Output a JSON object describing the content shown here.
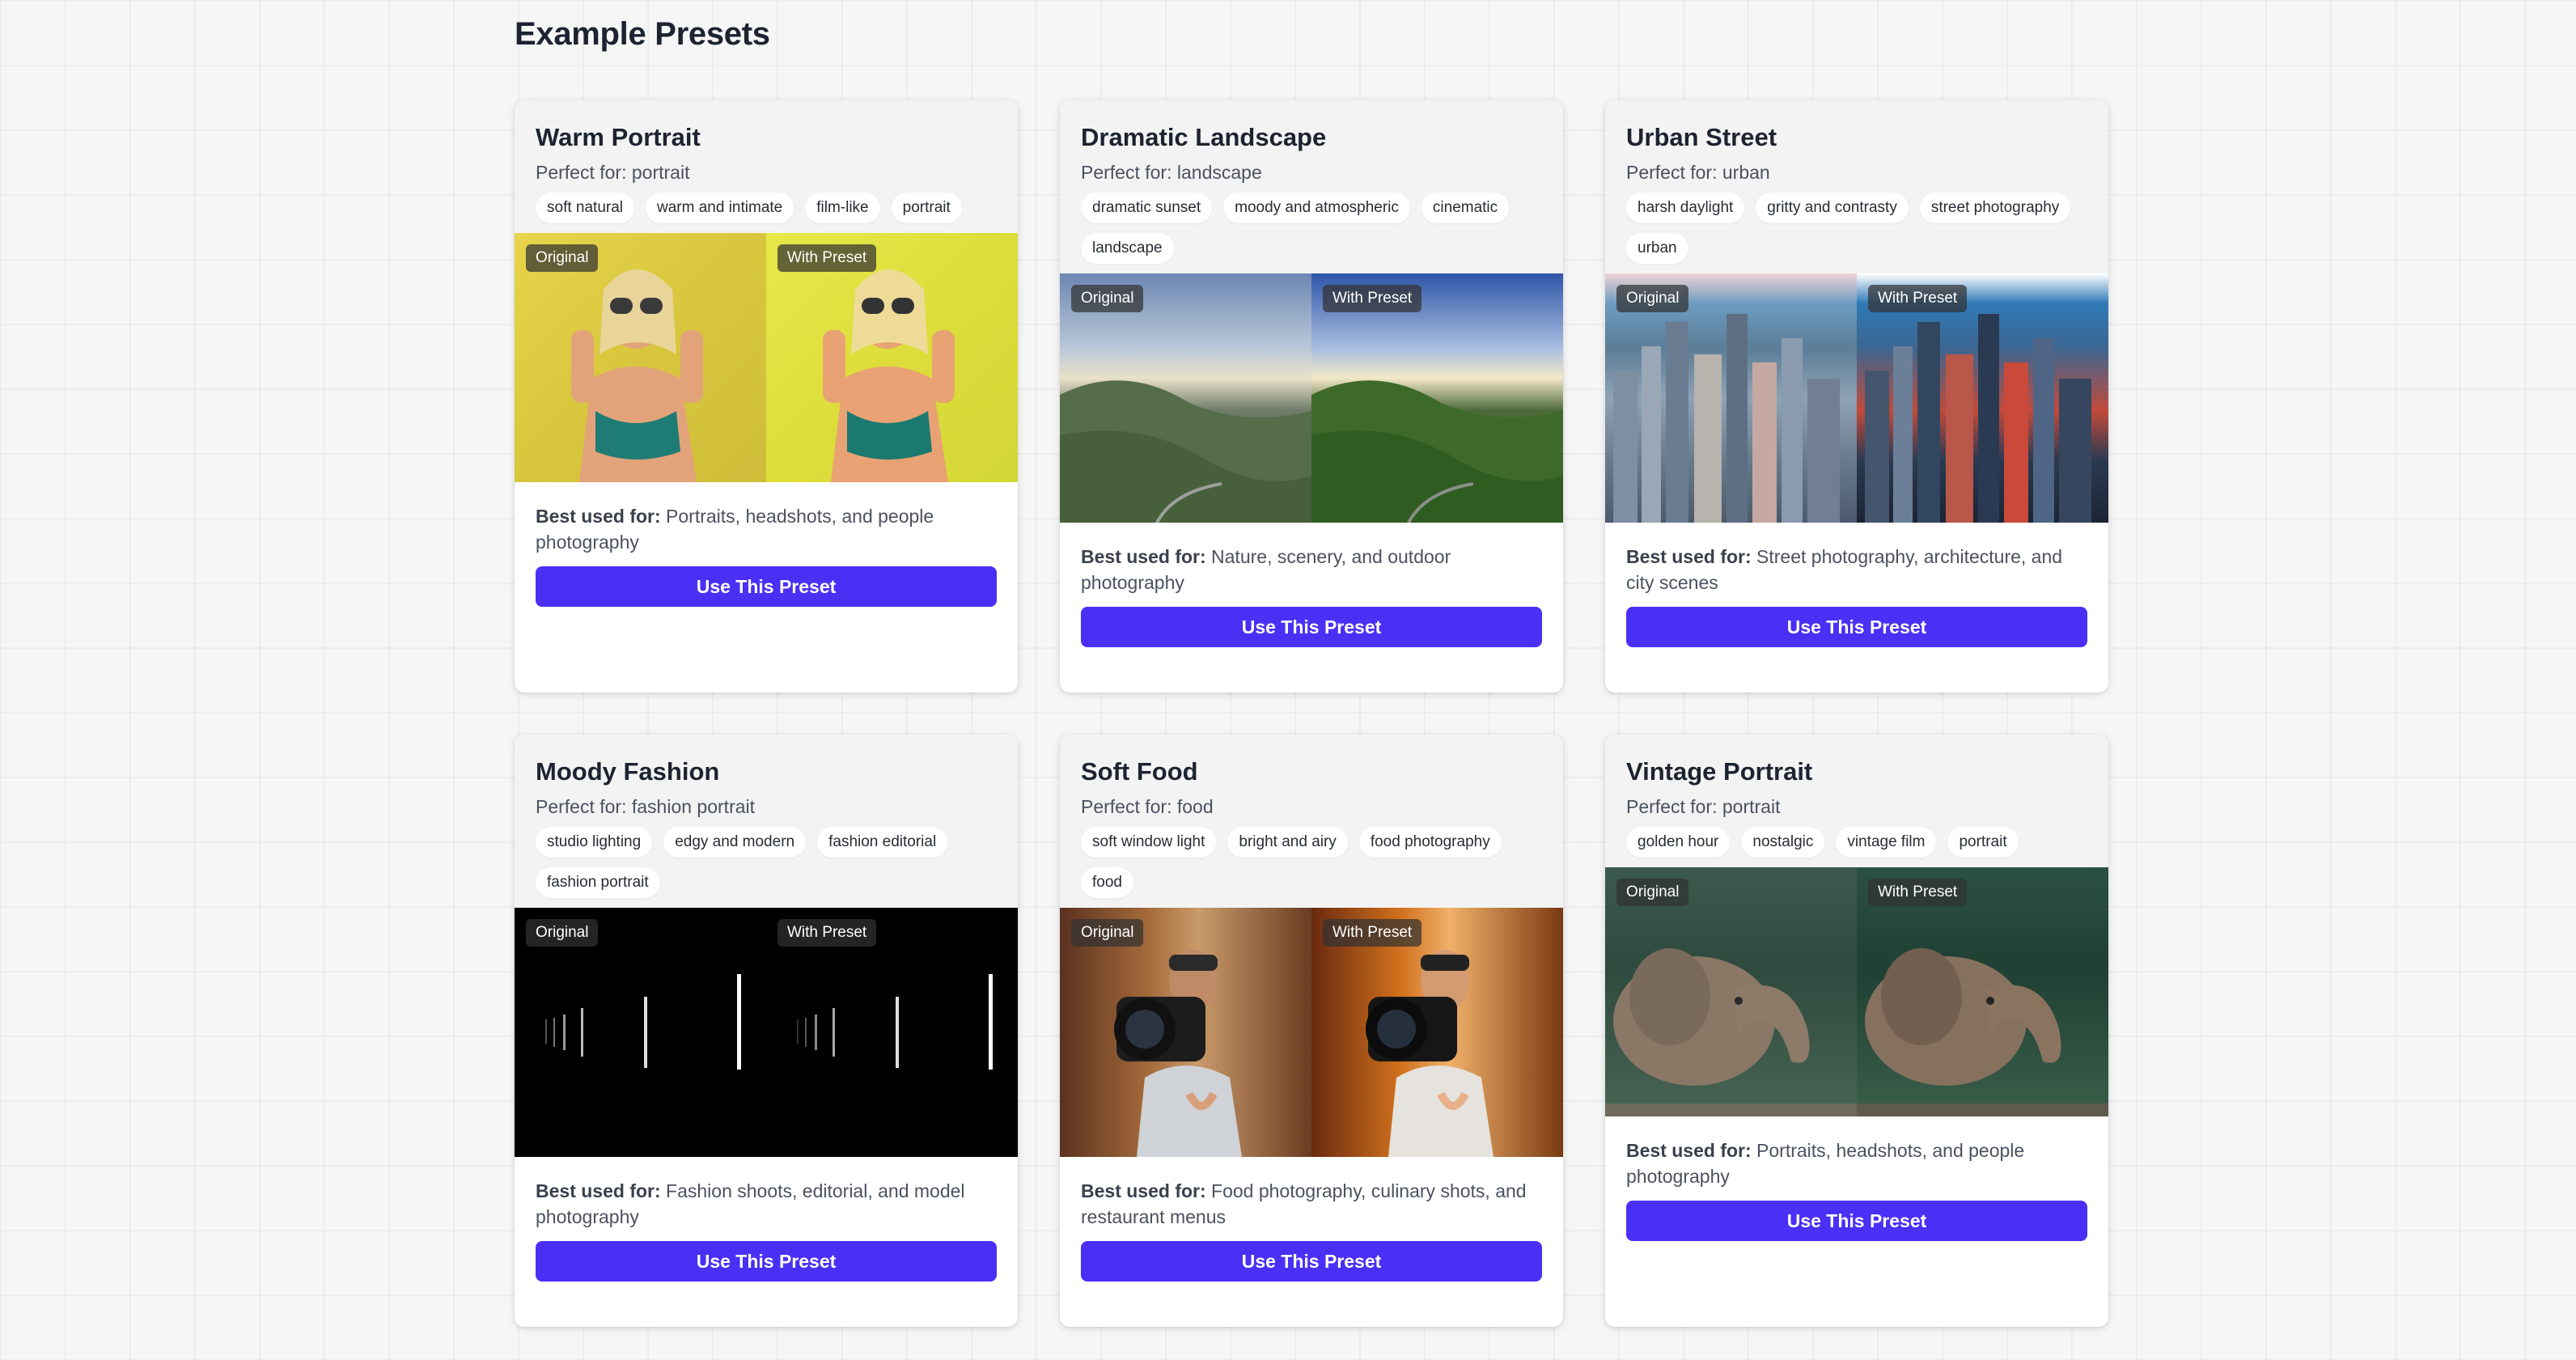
{
  "page": {
    "title": "Example Presets"
  },
  "labels": {
    "original": "Original",
    "with_preset": "With Preset",
    "best_prefix": "Best used for:",
    "button": "Use This Preset"
  },
  "presets": [
    {
      "title": "Warm Portrait",
      "perfect_for": "Perfect for: portrait",
      "tags": [
        "soft natural",
        "warm and intimate",
        "film-like",
        "portrait"
      ],
      "best_used_for": "Portraits, headshots, and people photography"
    },
    {
      "title": "Dramatic Landscape",
      "perfect_for": "Perfect for: landscape",
      "tags": [
        "dramatic sunset",
        "moody and atmospheric",
        "cinematic",
        "landscape"
      ],
      "best_used_for": "Nature, scenery, and outdoor photography"
    },
    {
      "title": "Urban Street",
      "perfect_for": "Perfect for: urban",
      "tags": [
        "harsh daylight",
        "gritty and contrasty",
        "street photography",
        "urban"
      ],
      "best_used_for": "Street photography, architecture, and city scenes"
    },
    {
      "title": "Moody Fashion",
      "perfect_for": "Perfect for: fashion portrait",
      "tags": [
        "studio lighting",
        "edgy and modern",
        "fashion editorial",
        "fashion portrait"
      ],
      "best_used_for": "Fashion shoots, editorial, and model photography"
    },
    {
      "title": "Soft Food",
      "perfect_for": "Perfect for: food",
      "tags": [
        "soft window light",
        "bright and airy",
        "food photography",
        "food"
      ],
      "best_used_for": "Food photography, culinary shots, and restaurant menus"
    },
    {
      "title": "Vintage Portrait",
      "perfect_for": "Perfect for: portrait",
      "tags": [
        "golden hour",
        "nostalgic",
        "vintage film",
        "portrait"
      ],
      "best_used_for": "Portraits, headshots, and people photography"
    }
  ]
}
